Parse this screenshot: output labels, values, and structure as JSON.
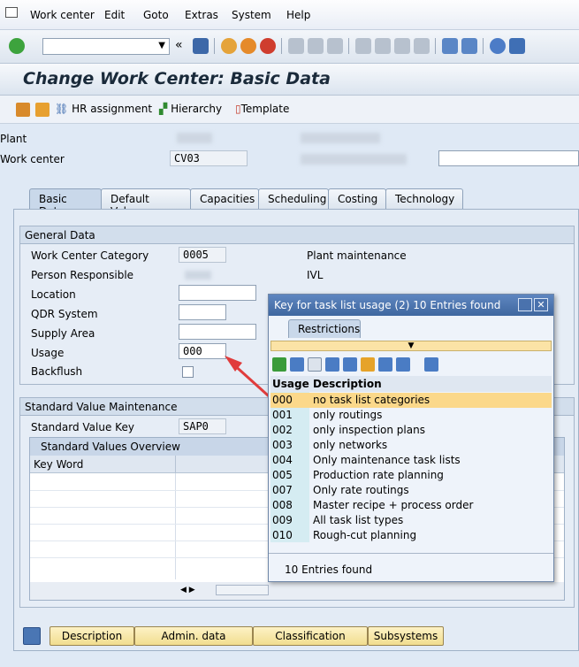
{
  "menu": [
    "Work center",
    "Edit",
    "Goto",
    "Extras",
    "System",
    "Help"
  ],
  "title": "Change Work Center: Basic Data",
  "app_toolbar": {
    "hr": "HR assignment",
    "hierarchy": "Hierarchy",
    "template": "Template"
  },
  "header": {
    "plant_label": "Plant",
    "workcenter_label": "Work center",
    "workcenter_value": "CV03"
  },
  "tabs": [
    "Basic Data",
    "Default Values",
    "Capacities",
    "Scheduling",
    "Costing",
    "Technology"
  ],
  "general": {
    "title": "General Data",
    "category_label": "Work Center Category",
    "category_value": "0005",
    "category_text": "Plant maintenance",
    "person_label": "Person Responsible",
    "person_text": "IVL",
    "location_label": "Location",
    "qdr_label": "QDR System",
    "supply_label": "Supply Area",
    "usage_label": "Usage",
    "usage_value": "000",
    "backflush_label": "Backflush"
  },
  "std": {
    "title": "Standard Value Maintenance",
    "key_label": "Standard Value Key",
    "key_value": "SAP0",
    "overview_title": "Standard Values Overview",
    "col_keyword": "Key Word"
  },
  "buttons": [
    "Description",
    "Admin. data",
    "Classification",
    "Subsystems"
  ],
  "popup": {
    "title": "Key for task list usage (2)   10 Entries found",
    "restrictions": "Restrictions",
    "col_usage": "Usage",
    "col_desc": "Description",
    "rows": [
      {
        "code": "000",
        "desc": "no task list categories"
      },
      {
        "code": "001",
        "desc": "only routings"
      },
      {
        "code": "002",
        "desc": "only inspection plans"
      },
      {
        "code": "003",
        "desc": "only networks"
      },
      {
        "code": "004",
        "desc": "Only maintenance task lists"
      },
      {
        "code": "005",
        "desc": "Production rate planning"
      },
      {
        "code": "007",
        "desc": "Only rate routings"
      },
      {
        "code": "008",
        "desc": "Master recipe + process order"
      },
      {
        "code": "009",
        "desc": "All task list types"
      },
      {
        "code": "010",
        "desc": "Rough-cut planning"
      }
    ],
    "footer": "10 Entries found"
  }
}
